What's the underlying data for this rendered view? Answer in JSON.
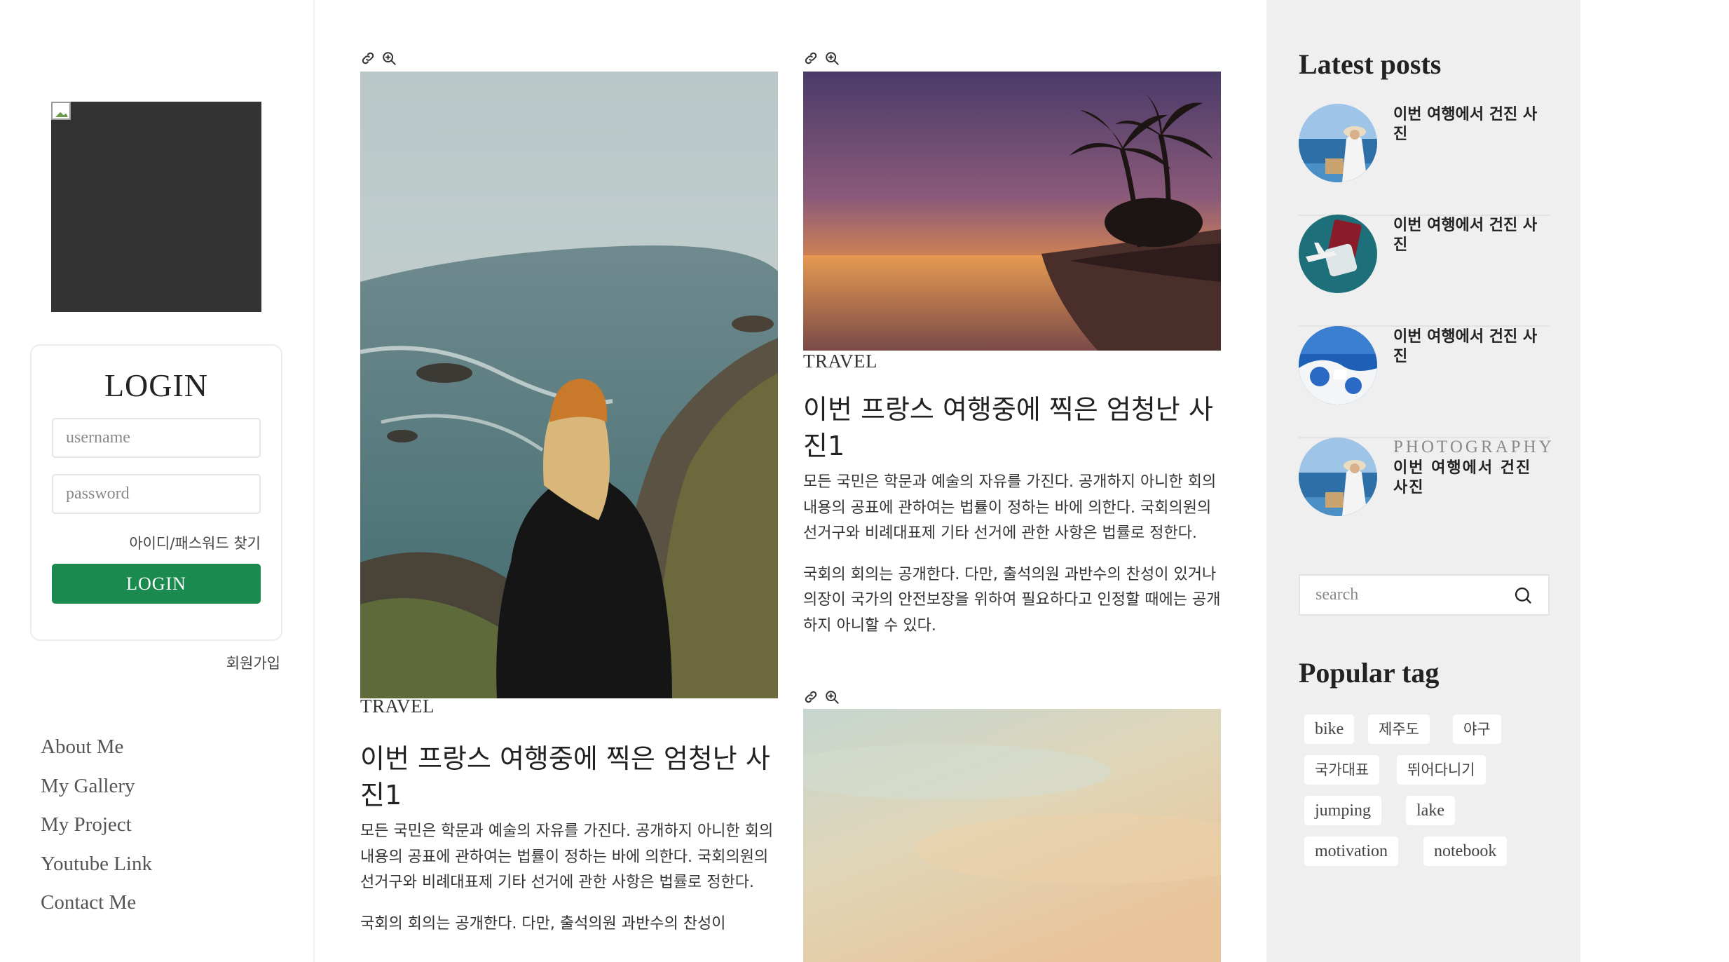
{
  "sidebar_left": {
    "profile_image": "broken-image-icon",
    "login": {
      "title": "LOGIN",
      "username_placeholder": "username",
      "password_placeholder": "password",
      "find_account": "아이디/패스워드 찾기",
      "button": "LOGIN"
    },
    "signup": "회원가입",
    "menu": [
      "About Me",
      "My Gallery",
      "My Project",
      "Youtube Link",
      "Contact Me"
    ]
  },
  "posts": [
    {
      "icons": [
        "link-icon",
        "zoom-in-icon"
      ],
      "category": "TRAVEL",
      "title": "이번 프랑스 여행중에 찍은 엄청난 사진1",
      "paragraphs": [
        "모든 국민은 학문과 예술의 자유를 가진다. 공개하지 아니한 회의내용의 공표에 관하여는 법률이 정하는 바에 의한다. 국회의원의 선거구와 비례대표제 기타 선거에 관한 사항은 법률로 정한다.",
        "국회의 회의는 공개한다. 다만, 출석의원 과반수의 찬성이"
      ]
    },
    {
      "icons": [
        "link-icon",
        "zoom-in-icon"
      ],
      "category": "TRAVEL",
      "title": "이번 프랑스 여행중에 찍은 엄청난 사진1",
      "paragraphs": [
        "모든 국민은 학문과 예술의 자유를 가진다. 공개하지 아니한 회의내용의 공표에 관하여는 법률이 정하는 바에 의한다. 국회의원의 선거구와 비례대표제 기타 선거에 관한 사항은 법률로 정한다.",
        "국회의 회의는 공개한다. 다만, 출석의원 과반수의 찬성이 있거나 의장이 국가의 안전보장을 위하여 필요하다고 인정할 때에는 공개하지 아니할 수 있다."
      ]
    },
    {
      "icons": [
        "link-icon",
        "zoom-in-icon"
      ]
    }
  ],
  "sidebar_right": {
    "latest_title": "Latest posts",
    "latest_posts": [
      {
        "category": "",
        "title": "이번 여행에서 건진 사진"
      },
      {
        "category": "",
        "title": "이번 여행에서 건진 사진"
      },
      {
        "category": "",
        "title": "이번 여행에서 건진 사진"
      },
      {
        "category": "PHOTOGRAPHY",
        "title": "이번 여행에서 건진 사진"
      }
    ],
    "search_placeholder": "search",
    "popular_title": "Popular tag",
    "tags": [
      "bike",
      "제주도",
      "야구",
      "국가대표",
      "뛰어다니기",
      "jumping",
      "lake",
      "motivation",
      "notebook"
    ]
  },
  "colors": {
    "accent_green": "#1a8a4f",
    "right_sidebar_bg": "#efefef"
  }
}
